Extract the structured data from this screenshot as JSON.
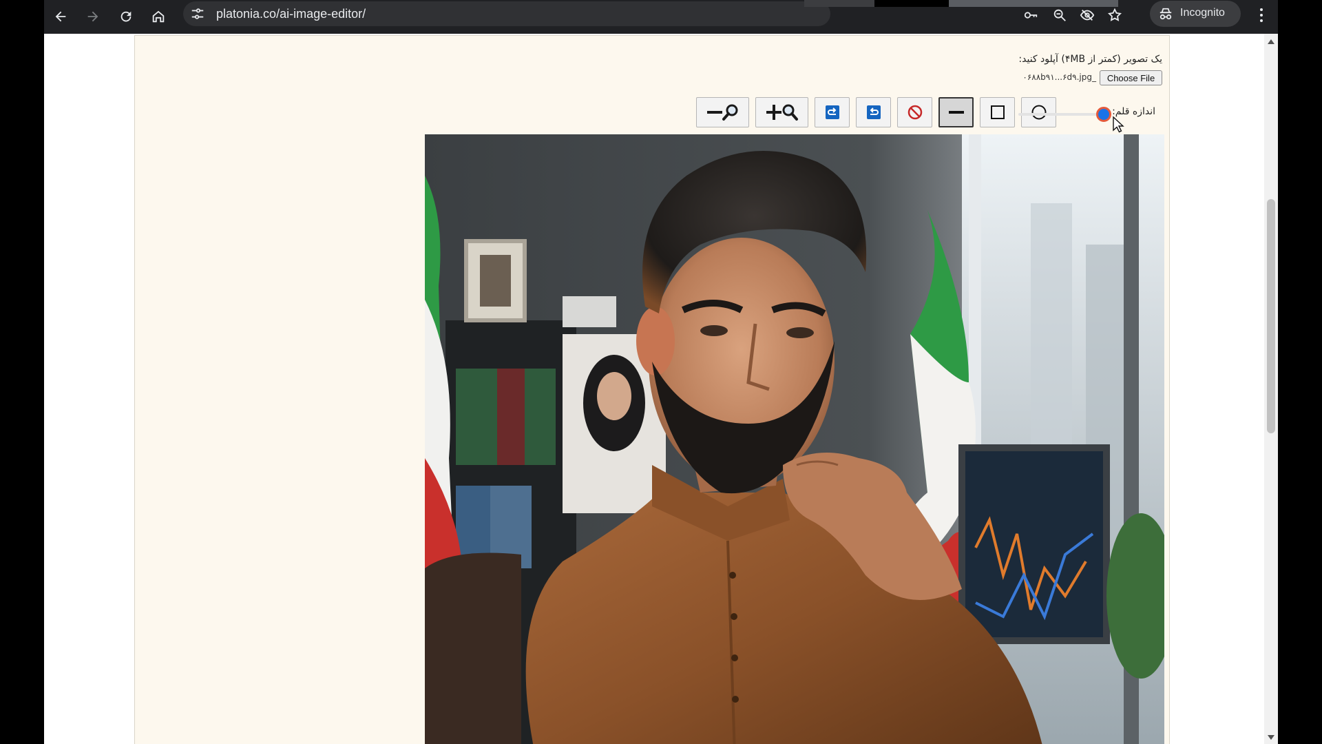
{
  "browser": {
    "url": "platonia.co/ai-image-editor/",
    "profile_label": "Incognito"
  },
  "uploader": {
    "label": "یک تصویر (کمتر از ۴MB) آپلود کنید:",
    "button_label": "Choose File",
    "file_name": "۰۶۸۸b۹۱...۶d۹.jpg_"
  },
  "toolbar": {
    "pen_size_label": "اندازه قلم:",
    "pen_size": 0.95,
    "tools": [
      {
        "name": "zoom-out-button",
        "icon": "zoom-out-icon"
      },
      {
        "name": "zoom-in-button",
        "icon": "zoom-in-icon"
      },
      {
        "name": "redo-button",
        "icon": "redo-icon"
      },
      {
        "name": "undo-button",
        "icon": "undo-icon"
      },
      {
        "name": "clear-button",
        "icon": "prohibited-icon"
      },
      {
        "name": "line-tool-button",
        "icon": "line-icon",
        "active": true
      },
      {
        "name": "rectangle-tool-button",
        "icon": "square-icon"
      },
      {
        "name": "circle-tool-button",
        "icon": "circle-icon"
      }
    ]
  },
  "colors": {
    "accent": "#1a73e8",
    "panel_bg": "#fdf8ee",
    "chrome_bg": "#202124"
  }
}
